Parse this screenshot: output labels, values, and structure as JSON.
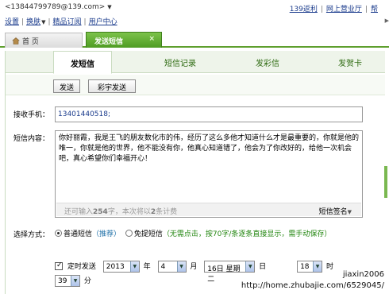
{
  "header": {
    "email": "<13844799789@139.com>",
    "links": [
      "139返利",
      "网上营业厅",
      "帮"
    ],
    "sub_links": [
      "设置",
      "换肤",
      "精品订阅",
      "用户中心"
    ]
  },
  "tabs": {
    "home_label": "首 页",
    "sms_label": "发送短信",
    "close_symbol": "×"
  },
  "subtabs": [
    "发短信",
    "短信记录",
    "发彩信",
    "发贺卡"
  ],
  "buttons": {
    "send": "发送",
    "color_send": "彩宇发送"
  },
  "form": {
    "recipient_label": "接收手机：",
    "recipient_value": "13401440518;",
    "content_label": "短信内容：",
    "content_text": "你好丽霞，我是王飞的朋友数化市的伟，经历了这么多他才知道什么才是最重要的，你就是他的唯一，你就是他的世界，他不能没有你，他真心知道错了，他会为了你改好的，给他一次机会吧，真心希望你们幸福开心！",
    "count_prefix": "还可输入",
    "count_number": "254",
    "count_suffix": "字，本次将以",
    "count_msgs": "2",
    "count_end": "条计费",
    "signature": "短信签名"
  },
  "method": {
    "label": "选择方式：",
    "normal": "普通短信",
    "normal_hint": "（推荐）",
    "free": "免提短信",
    "free_hint": "（无需点击，按70字/条逐条直接显示，需手动保存）"
  },
  "timing": {
    "label": "定时发送",
    "year": "2013",
    "year_unit": "年",
    "month": "4",
    "month_unit": "月",
    "day": "16日 星期二",
    "day_unit": "日",
    "hour": "18",
    "hour_unit": "时",
    "minute": "39",
    "minute_unit": "分"
  },
  "watermark": {
    "user": "jiaxin2006",
    "url": "http://home.zhubajie.com/6529045/"
  }
}
